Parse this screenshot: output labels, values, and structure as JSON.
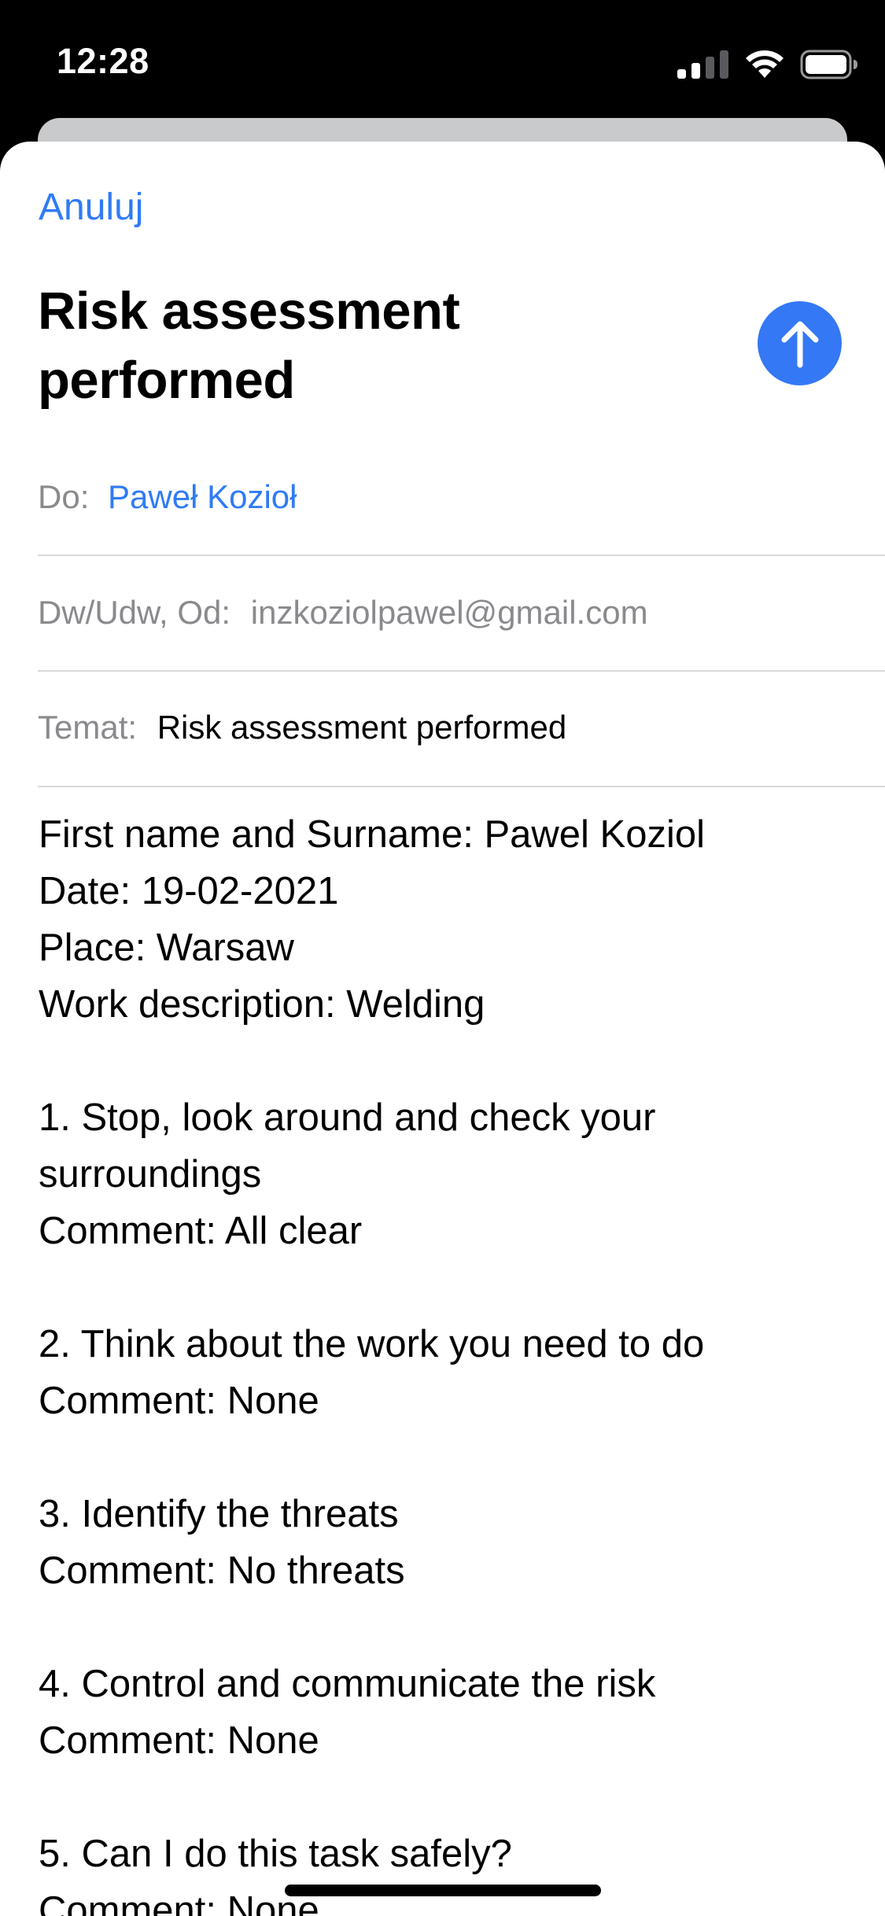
{
  "status_bar": {
    "time": "12:28"
  },
  "compose": {
    "cancel_label": "Anuluj",
    "title": "Risk assessment performed",
    "send_icon": "arrow-up-icon",
    "to": {
      "label": "Do:",
      "value": "Paweł Kozioł"
    },
    "cc_from": {
      "label": "Dw/Udw, Od:",
      "value": "inzkoziolpawel@gmail.com"
    },
    "subject": {
      "label": "Temat:",
      "value": "Risk assessment performed"
    },
    "body_lines": [
      "First name and Surname: Pawel Koziol",
      "Date: 19-02-2021",
      "Place: Warsaw",
      "Work description: Welding",
      "",
      "1. Stop, look around and check your",
      "surroundings",
      "Comment: All clear",
      "",
      "2. Think about the work you need to do",
      "Comment: None",
      "",
      "3. Identify the threats",
      "Comment: No threats",
      "",
      "4. Control and communicate the risk",
      "Comment: None",
      "",
      "5. Can I do this task safely?",
      "Comment: None"
    ]
  },
  "colors": {
    "accent": "#2f7bf5",
    "send_button": "#3478f6",
    "label_gray": "#8a8a8e"
  }
}
